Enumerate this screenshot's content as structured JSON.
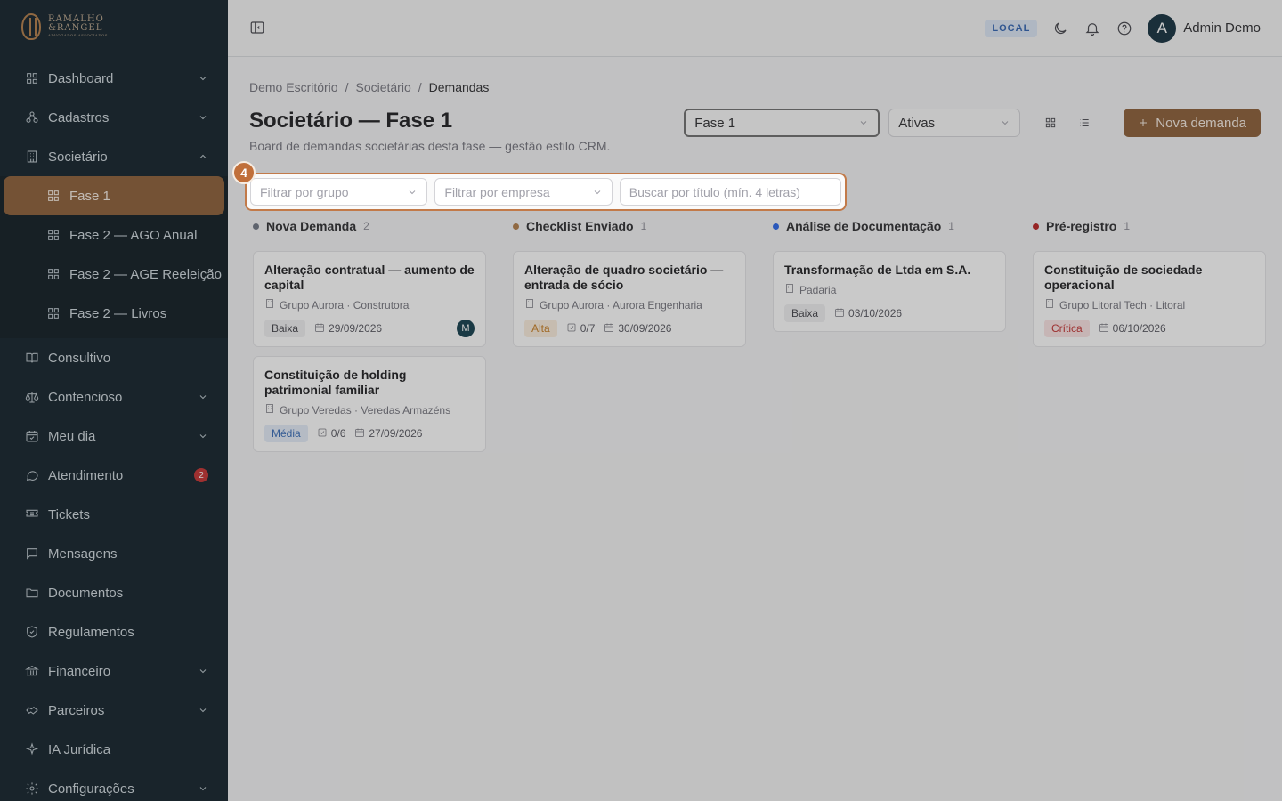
{
  "brand": {
    "line1": "RAMALHO",
    "line2": "&RANGEL",
    "tagline": "ADVOGADOS ASSOCIADOS"
  },
  "sidebar": {
    "items": [
      {
        "label": "Dashboard",
        "icon": "grid-icon",
        "chevron": "down"
      },
      {
        "label": "Cadastros",
        "icon": "network-icon",
        "chevron": "down"
      },
      {
        "label": "Societário",
        "icon": "building-icon",
        "chevron": "up"
      },
      {
        "label": "Consultivo",
        "icon": "book-icon"
      },
      {
        "label": "Contencioso",
        "icon": "scale-icon",
        "chevron": "down"
      },
      {
        "label": "Meu dia",
        "icon": "calendar-check-icon",
        "chevron": "down"
      },
      {
        "label": "Atendimento",
        "icon": "message-circle-icon",
        "badge": "2"
      },
      {
        "label": "Tickets",
        "icon": "ticket-icon"
      },
      {
        "label": "Mensagens",
        "icon": "message-square-icon"
      },
      {
        "label": "Documentos",
        "icon": "folder-icon"
      },
      {
        "label": "Regulamentos",
        "icon": "shield-icon"
      },
      {
        "label": "Financeiro",
        "icon": "bank-icon",
        "chevron": "down"
      },
      {
        "label": "Parceiros",
        "icon": "handshake-icon",
        "chevron": "down"
      },
      {
        "label": "IA Jurídica",
        "icon": "sparkles-icon"
      },
      {
        "label": "Configurações",
        "icon": "gear-icon",
        "chevron": "down"
      }
    ],
    "sub_items": [
      {
        "label": "Fase 1",
        "active": true
      },
      {
        "label": "Fase 2 — AGO Anual"
      },
      {
        "label": "Fase 2 — AGE Reeleição"
      },
      {
        "label": "Fase 2 — Livros"
      }
    ]
  },
  "topbar": {
    "env": "LOCAL",
    "user_initial": "A",
    "user_name": "Admin Demo"
  },
  "breadcrumb": [
    "Demo Escritório",
    "Societário",
    "Demandas"
  ],
  "page": {
    "title": "Societário — Fase 1",
    "subtitle": "Board de demandas societárias desta fase — gestão estilo CRM.",
    "phase_select": "Fase 1",
    "status_select": "Ativas",
    "new_button": "Nova demanda"
  },
  "filters": {
    "step": "4",
    "group_placeholder": "Filtrar por grupo",
    "company_placeholder": "Filtrar por empresa",
    "search_placeholder": "Buscar por título (mín. 4 letras)"
  },
  "columns": [
    {
      "name": "Nova Demanda",
      "count": "2",
      "color": "#6b7280",
      "cards": [
        {
          "title": "Alteração contratual — aumento de capital",
          "org": "Grupo Aurora · Construtora",
          "priority": "Baixa",
          "prio_class": "baixa",
          "checklist": "",
          "date": "29/09/2026",
          "assignee": "M"
        },
        {
          "title": "Constituição de holding patrimonial familiar",
          "org": "Grupo Veredas · Veredas Armazéns",
          "priority": "Média",
          "prio_class": "media",
          "checklist": "0/6",
          "date": "27/09/2026",
          "assignee": ""
        }
      ]
    },
    {
      "name": "Checklist Enviado",
      "count": "1",
      "color": "#b07a45",
      "cards": [
        {
          "title": "Alteração de quadro societário — entrada de sócio",
          "org": "Grupo Aurora · Aurora Engenharia",
          "priority": "Alta",
          "prio_class": "alta",
          "checklist": "0/7",
          "date": "30/09/2026",
          "assignee": ""
        }
      ]
    },
    {
      "name": "Análise de Documentação",
      "count": "1",
      "color": "#2563eb",
      "cards": [
        {
          "title": "Transformação de Ltda em S.A.",
          "org": "Padaria",
          "priority": "Baixa",
          "prio_class": "baixa",
          "checklist": "",
          "date": "03/10/2026",
          "assignee": ""
        }
      ]
    },
    {
      "name": "Pré-registro",
      "count": "1",
      "color": "#b91c1c",
      "cards": [
        {
          "title": "Constituição de sociedade operacional",
          "org": "Grupo Litoral Tech · Litoral",
          "priority": "Crítica",
          "prio_class": "critica",
          "checklist": "",
          "date": "06/10/2026",
          "assignee": ""
        }
      ]
    }
  ]
}
